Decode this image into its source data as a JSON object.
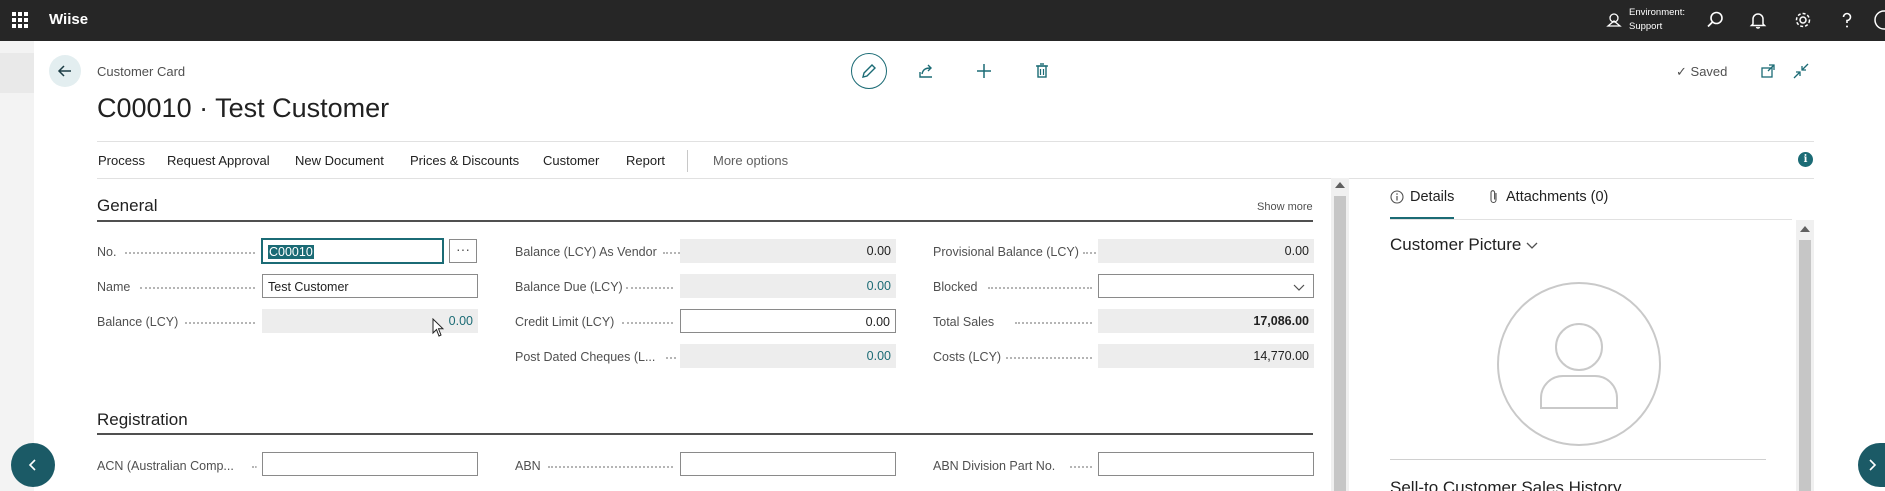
{
  "app": {
    "brand": "Wiise"
  },
  "environment": {
    "line1": "Environment:",
    "line2": "Support"
  },
  "header": {
    "breadcrumb": "Customer Card",
    "title": "C00010 · Test Customer",
    "saved_label": "Saved"
  },
  "menu": {
    "items": [
      "Process",
      "Request Approval",
      "New Document",
      "Prices & Discounts",
      "Customer",
      "Report"
    ],
    "more_options": "More options"
  },
  "general": {
    "title": "General",
    "show_more": "Show more",
    "fields": {
      "no": {
        "label": "No.",
        "value": "C00010"
      },
      "name": {
        "label": "Name",
        "value": "Test Customer"
      },
      "balance_lcy": {
        "label": "Balance (LCY)",
        "value": "0.00"
      },
      "balance_as_vendor": {
        "label": "Balance (LCY) As Vendor",
        "value": "0.00"
      },
      "balance_due": {
        "label": "Balance Due (LCY)",
        "value": "0.00"
      },
      "credit_limit": {
        "label": "Credit Limit (LCY)",
        "value": "0.00"
      },
      "post_dated_cheques": {
        "label": "Post Dated Cheques (L...",
        "value": "0.00"
      },
      "provisional_balance": {
        "label": "Provisional Balance (LCY)",
        "value": "0.00"
      },
      "blocked": {
        "label": "Blocked",
        "value": ""
      },
      "total_sales": {
        "label": "Total Sales",
        "value": "17,086.00"
      },
      "costs": {
        "label": "Costs (LCY)",
        "value": "14,770.00"
      }
    }
  },
  "registration": {
    "title": "Registration",
    "fields": {
      "acn": {
        "label": "ACN (Australian Comp...",
        "value": ""
      },
      "abn": {
        "label": "ABN",
        "value": ""
      },
      "abn_division": {
        "label": "ABN Division Part No.",
        "value": ""
      }
    }
  },
  "factbox": {
    "tabs": [
      "Details",
      "Attachments (0)"
    ],
    "picture_title": "Customer Picture",
    "history_title": "Sell-to Customer Sales History"
  },
  "colors": {
    "accent": "#1b6b75",
    "topbar": "#262626",
    "nav_button": "#1b5a66"
  }
}
